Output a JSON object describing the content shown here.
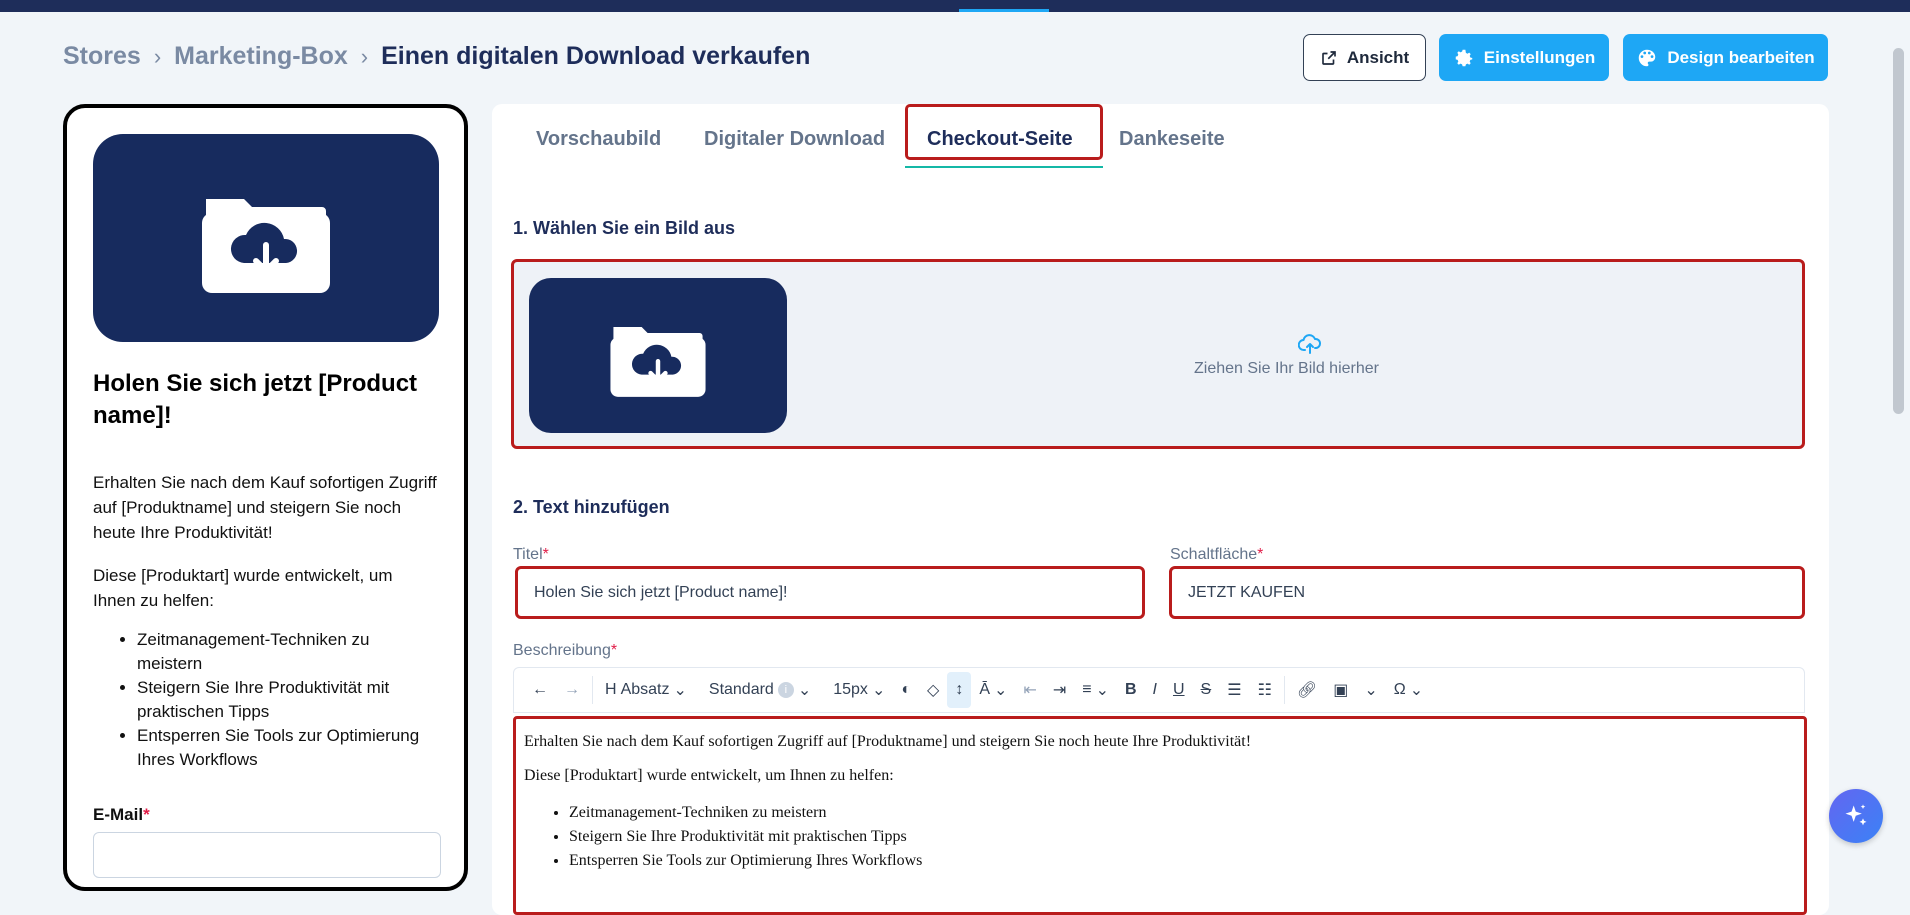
{
  "breadcrumb": {
    "items": [
      "Stores",
      "Marketing-Box"
    ],
    "current": "Einen digitalen Download verkaufen"
  },
  "header_buttons": {
    "view": "Ansicht",
    "settings": "Einstellungen",
    "design": "Design bearbeiten"
  },
  "preview": {
    "title": "Holen Sie sich jetzt [Product name]!",
    "paragraph1": "Erhalten Sie nach dem Kauf sofortigen Zugriff auf [Produktname] und steigern Sie noch heute Ihre Produktivität!",
    "paragraph2": "Diese [Produktart] wurde entwickelt, um Ihnen zu helfen:",
    "list": [
      "Zeitmanagement-Techniken zu meistern",
      "Steigern Sie Ihre Produktivität mit praktischen Tipps",
      "Entsperren Sie Tools zur Optimierung Ihres Workflows"
    ],
    "email_label": "E-Mail",
    "required_mark": "*"
  },
  "tabs": [
    {
      "label": "Vorschaubild",
      "active": false
    },
    {
      "label": "Digitaler Download",
      "active": false
    },
    {
      "label": "Checkout-Seite",
      "active": true
    },
    {
      "label": "Dankeseite",
      "active": false
    }
  ],
  "section1": {
    "heading": "1. Wählen Sie ein Bild aus",
    "dropzone_text": "Ziehen Sie Ihr Bild hierher"
  },
  "section2": {
    "heading": "2. Text hinzufügen",
    "title_label": "Titel",
    "title_value": "Holen Sie sich jetzt [Product name]!",
    "button_label": "Schaltfläche",
    "button_value": "JETZT KAUFEN",
    "description_label": "Beschreibung"
  },
  "toolbar": {
    "heading": "Absatz",
    "font": "Standard",
    "size": "15px"
  },
  "description": {
    "paragraph1": "Erhalten Sie nach dem Kauf sofortigen Zugriff auf [Produktname] und steigern Sie noch heute Ihre Produktivität!",
    "paragraph2": "Diese [Produktart] wurde entwickelt, um Ihnen zu helfen:",
    "list": [
      "Zeitmanagement-Techniken zu meistern",
      "Steigern Sie Ihre Produktivität mit praktischen Tipps",
      "Entsperren Sie Tools zur Optimierung Ihres Workflows"
    ]
  },
  "colors": {
    "navy": "#172b5e",
    "accent_blue": "#1ea7f5",
    "highlight_red": "#b91c1c"
  }
}
